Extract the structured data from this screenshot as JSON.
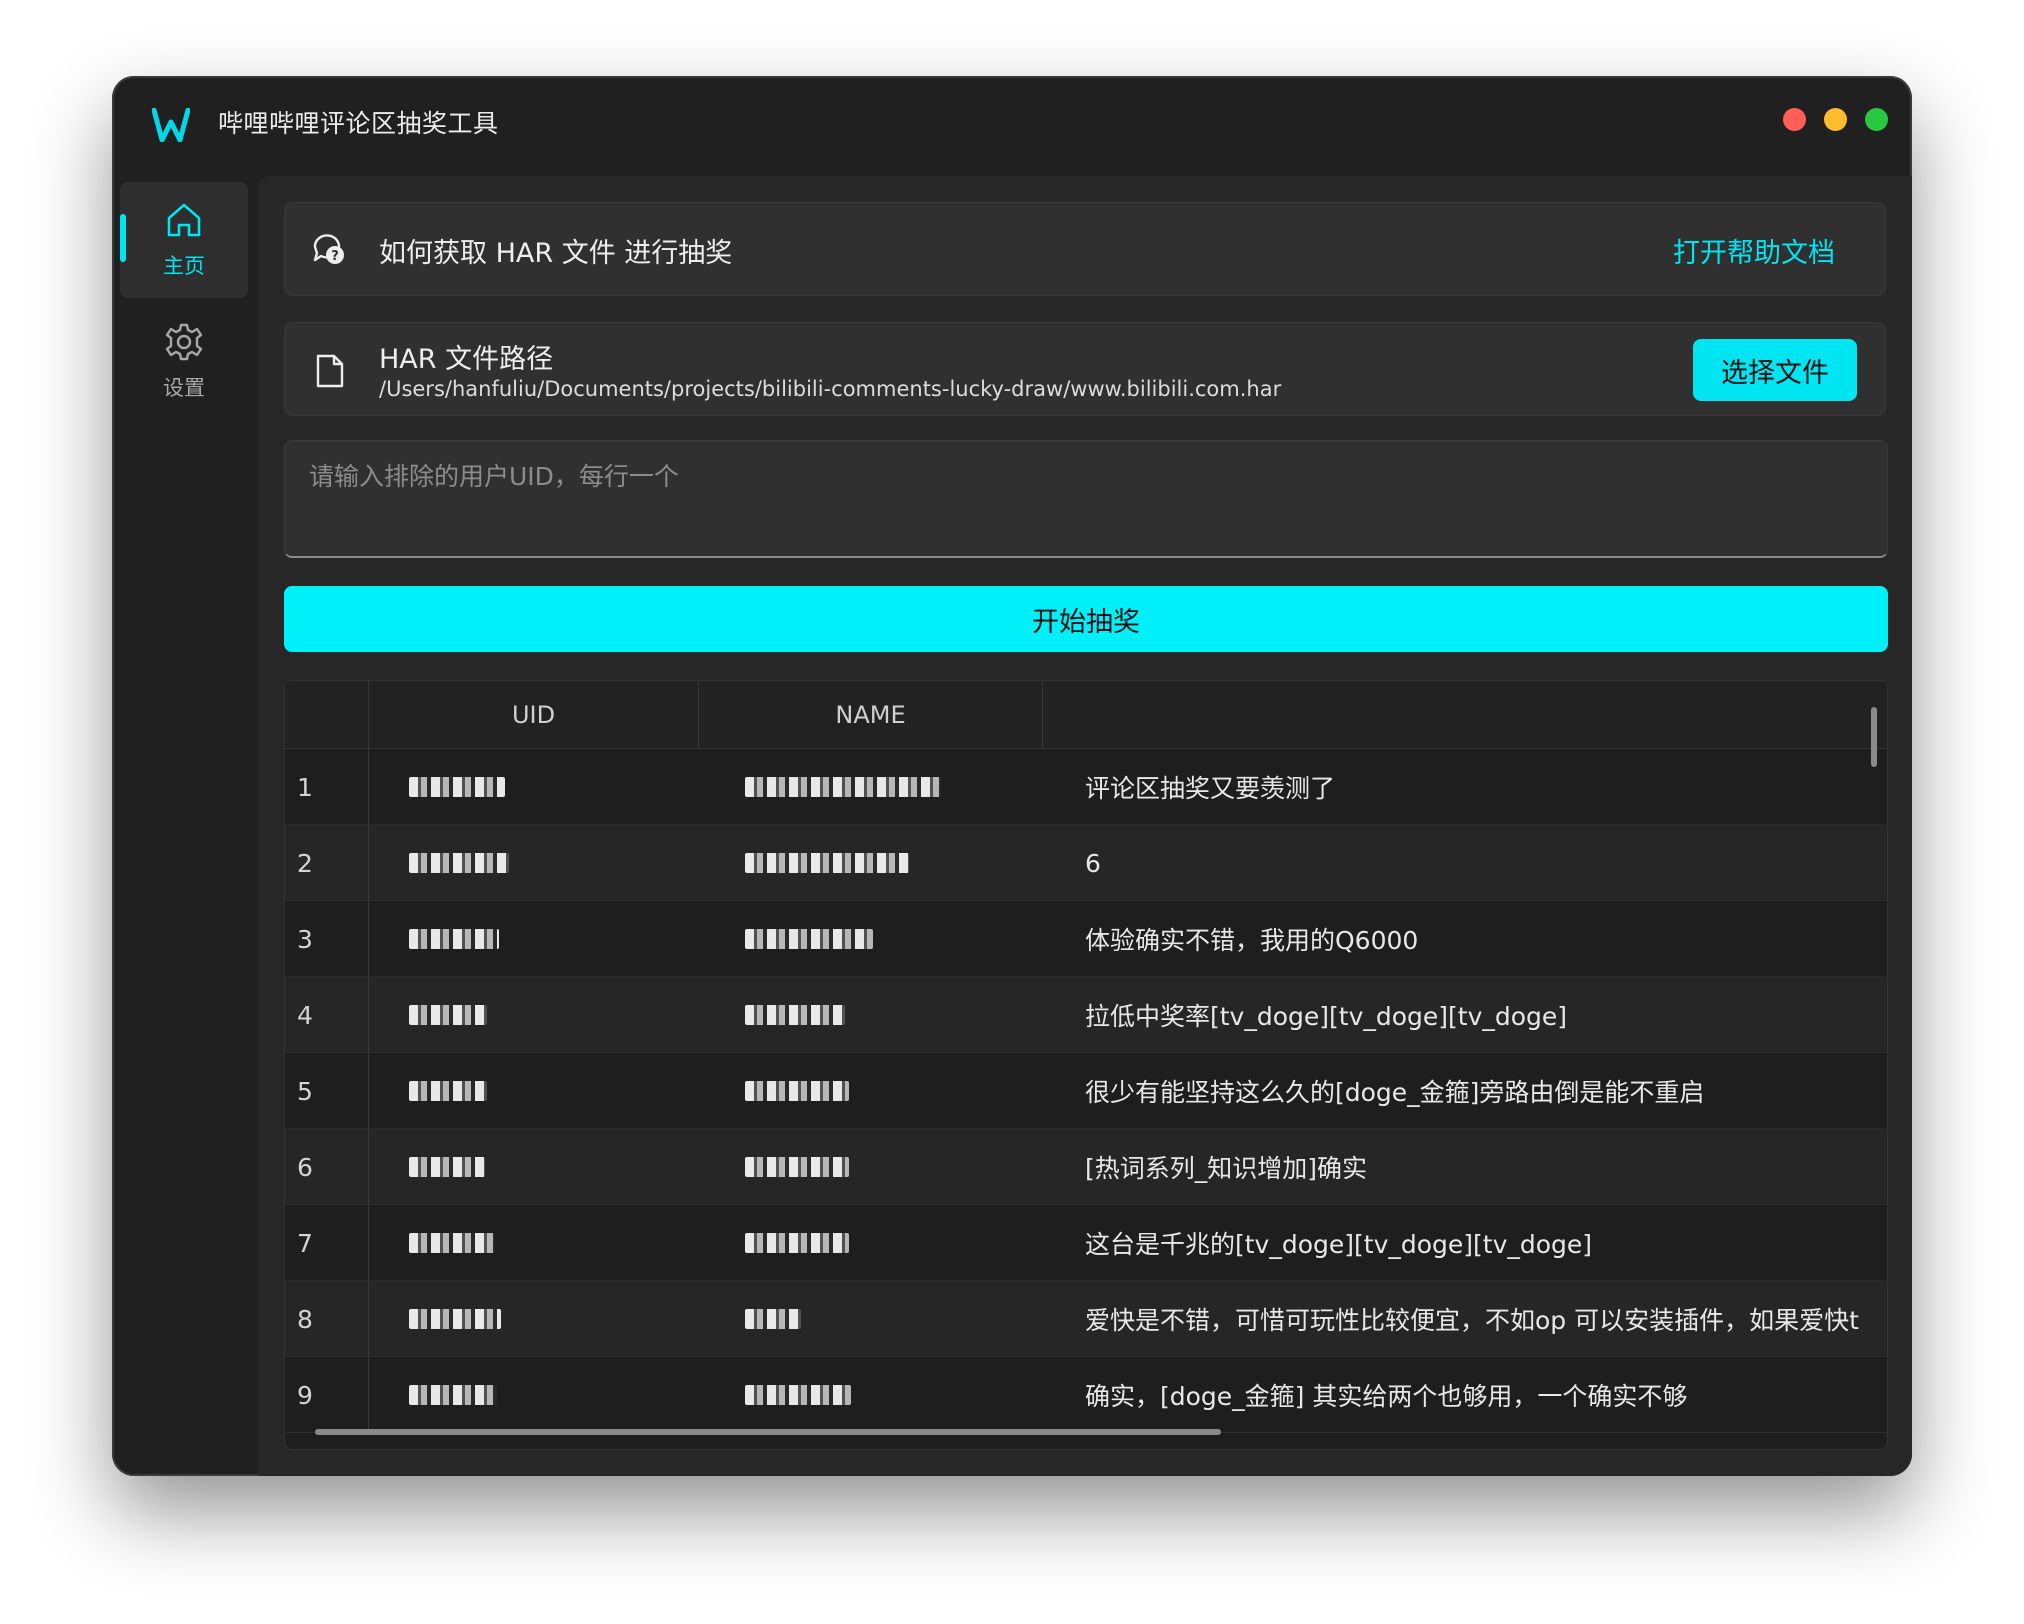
{
  "window": {
    "title": "哔哩哔哩评论区抽奖工具",
    "colors": {
      "accent": "#00e5f2",
      "close": "#ff5f57",
      "minimize": "#febc2e",
      "maximize": "#28c840"
    }
  },
  "sidebar": {
    "items": [
      {
        "label": "主页",
        "icon": "home-icon",
        "active": true
      },
      {
        "label": "设置",
        "icon": "gear-icon",
        "active": false
      }
    ]
  },
  "help_card": {
    "text": "如何获取 HAR 文件 进行抽奖",
    "link_label": "打开帮助文档",
    "icon": "help-chat-icon"
  },
  "file_card": {
    "title": "HAR 文件路径",
    "path": "/Users/hanfuliu/Documents/projects/bilibili-comments-lucky-draw/www.bilibili.com.har",
    "button_label": "选择文件",
    "icon": "file-icon"
  },
  "exclude_input": {
    "placeholder": "请输入排除的用户UID，每行一个",
    "value": ""
  },
  "start_button": {
    "label": "开始抽奖"
  },
  "table": {
    "columns": [
      "",
      "UID",
      "NAME",
      ""
    ],
    "rows": [
      {
        "index": "1",
        "comment": "评论区抽奖又要羡测了"
      },
      {
        "index": "2",
        "comment": "6"
      },
      {
        "index": "3",
        "comment": "体验确实不错，我用的Q6000"
      },
      {
        "index": "4",
        "comment": "拉低中奖率[tv_doge][tv_doge][tv_doge]"
      },
      {
        "index": "5",
        "comment": "很少有能坚持这么久的[doge_金箍]旁路由倒是能不重启"
      },
      {
        "index": "6",
        "comment": "[热词系列_知识增加]确实"
      },
      {
        "index": "7",
        "comment": "这台是千兆的[tv_doge][tv_doge][tv_doge]"
      },
      {
        "index": "8",
        "comment": "爱快是不错，可惜可玩性比较便宜，不如op 可以安装插件，如果爱快t"
      },
      {
        "index": "9",
        "comment": "确实，[doge_金箍] 其实给两个也够用，一个确实不够"
      }
    ]
  }
}
